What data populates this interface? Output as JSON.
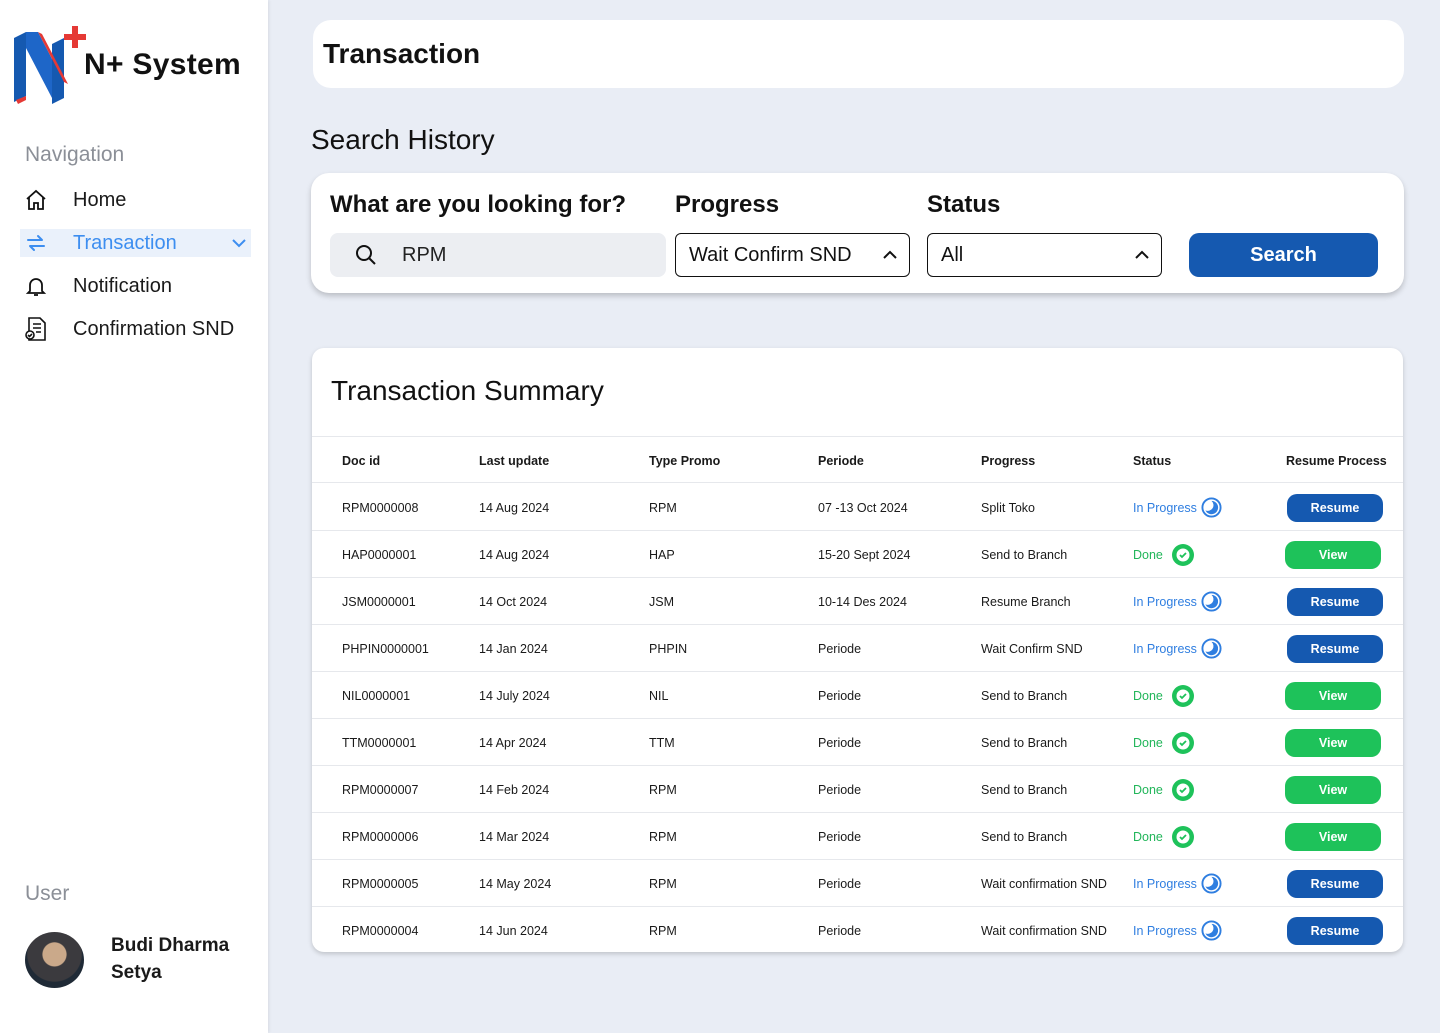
{
  "app": {
    "name": "N+ System"
  },
  "sidebar": {
    "nav_title": "Navigation",
    "items": [
      {
        "label": "Home",
        "icon": "home-icon"
      },
      {
        "label": "Transaction",
        "icon": "transfer-icon",
        "active": true
      },
      {
        "label": "Notification",
        "icon": "bell-icon"
      },
      {
        "label": "Confirmation SND",
        "icon": "document-check-icon"
      }
    ],
    "user_title": "User",
    "user_name": "Budi Dharma Setya"
  },
  "header": {
    "title": "Transaction"
  },
  "search": {
    "section_title": "Search History",
    "query_label": "What are you looking for?",
    "query_value": "RPM",
    "progress_label": "Progress",
    "progress_value": "Wait Confirm SND",
    "status_label": "Status",
    "status_value": "All",
    "button_label": "Search"
  },
  "summary": {
    "title": "Transaction Summary",
    "columns": [
      "Doc id",
      "Last update",
      "Type Promo",
      "Periode",
      "Progress",
      "Status",
      "Resume Process"
    ],
    "rows": [
      {
        "doc_id": "RPM0000008",
        "last_update": "14 Aug 2024",
        "type": "RPM",
        "periode": "07 -13 Oct 2024",
        "progress": "Split Toko",
        "status": "In Progress",
        "action": "Resume"
      },
      {
        "doc_id": "HAP0000001",
        "last_update": "14 Aug 2024",
        "type": "HAP",
        "periode": "15-20 Sept 2024",
        "progress": "Send to Branch",
        "status": "Done",
        "action": "View"
      },
      {
        "doc_id": "JSM0000001",
        "last_update": "14 Oct 2024",
        "type": "JSM",
        "periode": "10-14 Des 2024",
        "progress": "Resume Branch",
        "status": "In Progress",
        "action": "Resume"
      },
      {
        "doc_id": "PHPIN0000001",
        "last_update": "14 Jan 2024",
        "type": "PHPIN",
        "periode": "Periode",
        "progress": "Wait Confirm SND",
        "status": "In Progress",
        "action": "Resume"
      },
      {
        "doc_id": "NIL0000001",
        "last_update": "14 July 2024",
        "type": "NIL",
        "periode": "Periode",
        "progress": "Send to Branch",
        "status": "Done",
        "action": "View"
      },
      {
        "doc_id": "TTM0000001",
        "last_update": "14 Apr 2024",
        "type": "TTM",
        "periode": "Periode",
        "progress": "Send to Branch",
        "status": "Done",
        "action": "View"
      },
      {
        "doc_id": "RPM0000007",
        "last_update": "14 Feb 2024",
        "type": "RPM",
        "periode": "Periode",
        "progress": "Send to Branch",
        "status": "Done",
        "action": "View"
      },
      {
        "doc_id": "RPM0000006",
        "last_update": "14 Mar 2024",
        "type": "RPM",
        "periode": "Periode",
        "progress": "Send to Branch",
        "status": "Done",
        "action": "View"
      },
      {
        "doc_id": "RPM0000005",
        "last_update": "14 May 2024",
        "type": "RPM",
        "periode": "Periode",
        "progress": "Wait confirmation SND",
        "status": "In Progress",
        "action": "Resume"
      },
      {
        "doc_id": "RPM0000004",
        "last_update": "14 Jun 2024",
        "type": "RPM",
        "periode": "Periode",
        "progress": "Wait confirmation SND",
        "status": "In Progress",
        "action": "Resume"
      }
    ]
  },
  "colors": {
    "primary": "#1559b0",
    "accent_blue": "#3d8ef0",
    "done_green": "#1ec25a",
    "background": "#e9edf5"
  }
}
